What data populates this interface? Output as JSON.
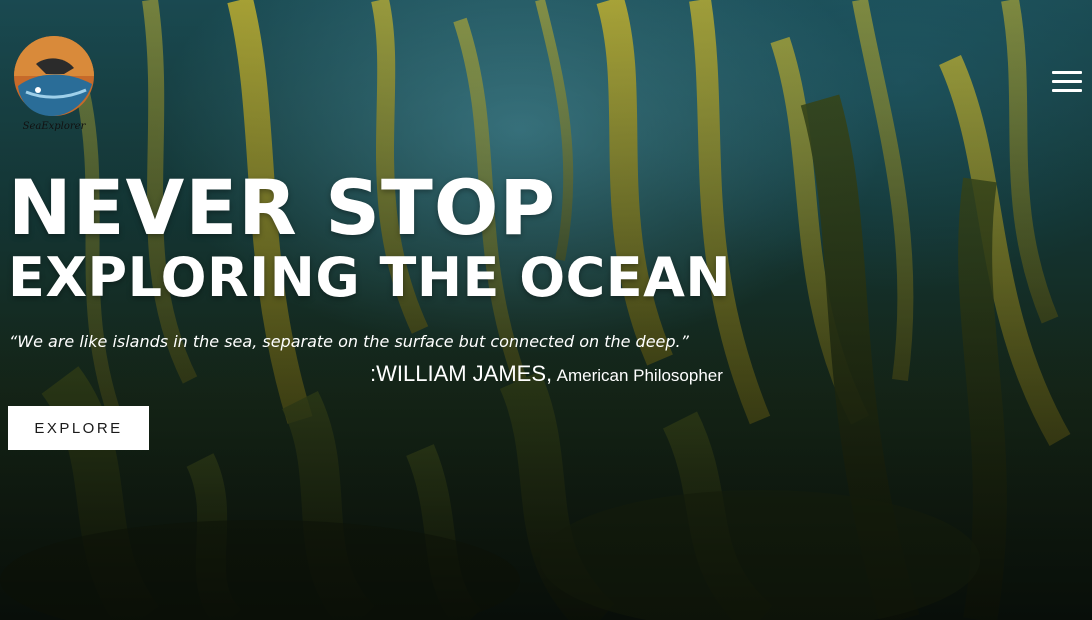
{
  "header": {
    "logo_text": "SeaExplorer",
    "menu_icon": "hamburger-menu-icon"
  },
  "hero": {
    "headline_line1": "NEVER STOP",
    "headline_line2": "EXPLORING THE OCEAN",
    "quote": "“We are like islands in the sea, separate on the surface but connected on the deep.”",
    "attribution_name": ":WILLIAM JAMES,",
    "attribution_role": "American Philosopher",
    "cta_label": "EXPLORE"
  },
  "colors": {
    "text": "#ffffff",
    "button_bg": "#ffffff",
    "button_text": "#1a1a1a",
    "water_top": "#1b4d55",
    "kelp": "#b8a62a"
  }
}
